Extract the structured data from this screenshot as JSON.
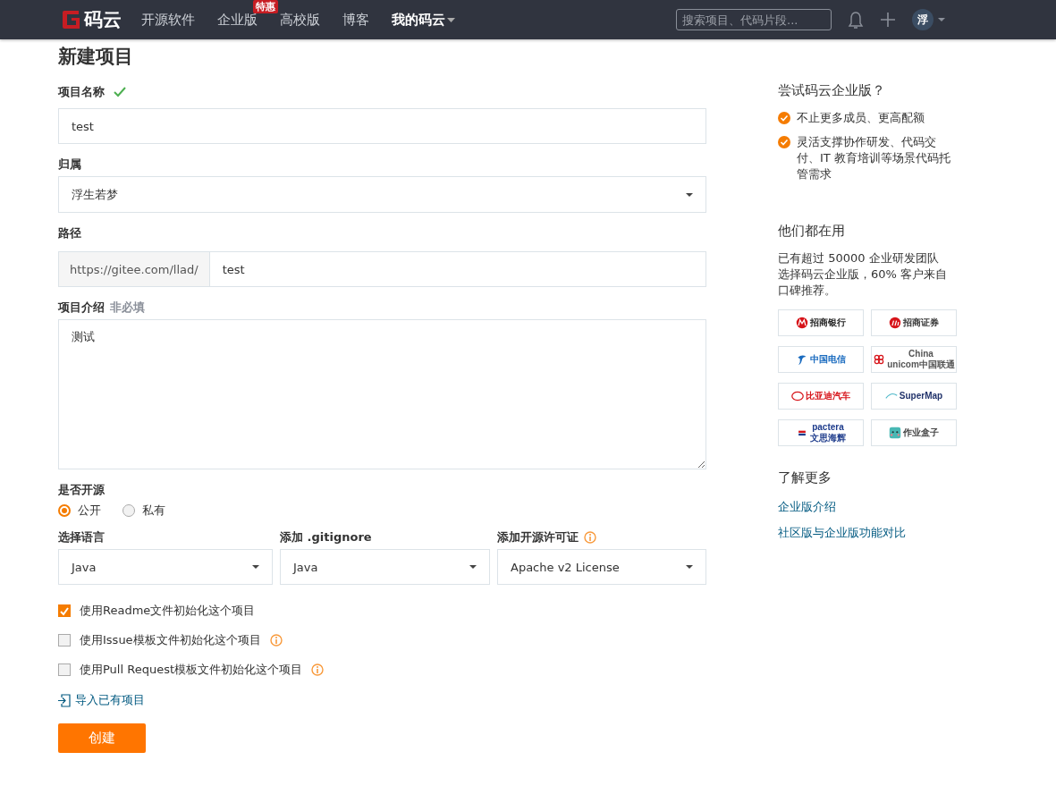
{
  "header": {
    "brand": "码云",
    "nav": [
      {
        "label": "开源软件",
        "dropdown": false
      },
      {
        "label": "企业版",
        "badge": "特惠",
        "dropdown": false
      },
      {
        "label": "高校版",
        "dropdown": false
      },
      {
        "label": "博客",
        "dropdown": false
      },
      {
        "label": "我的码云",
        "dropdown": true
      }
    ],
    "search": {
      "placeholder": "搜索项目、代码片段..."
    },
    "avatar": "浮"
  },
  "page_title": "新建项目",
  "form": {
    "name": {
      "label": "项目名称",
      "valid": true,
      "value": "test"
    },
    "owner": {
      "label": "归属",
      "value": "浮生若梦"
    },
    "path": {
      "label": "路径",
      "prefix": "https://gitee.com/llad/",
      "value": "test"
    },
    "description": {
      "label": "项目介绍",
      "hint": "非必填",
      "value": "测试"
    },
    "visibility": {
      "label": "是否开源",
      "options": [
        {
          "label": "公开",
          "selected": true
        },
        {
          "label": "私有",
          "selected": false
        }
      ]
    },
    "selects": [
      {
        "label": "选择语言",
        "value": "Java",
        "info": false
      },
      {
        "label": "添加 .gitignore",
        "value": "Java",
        "info": false
      },
      {
        "label": "添加开源许可证",
        "value": "Apache v2 License",
        "info": true
      }
    ],
    "checkboxes": [
      {
        "label": "使用Readme文件初始化这个项目",
        "checked": true,
        "info": false
      },
      {
        "label": "使用Issue模板文件初始化这个项目",
        "checked": false,
        "info": true
      },
      {
        "label": "使用Pull Request模板文件初始化这个项目",
        "checked": false,
        "info": true
      }
    ],
    "import_link": "导入已有项目",
    "submit": "创建"
  },
  "sidebar": {
    "promo_title": "尝试码云企业版？",
    "promo_items": [
      "不止更多成员、更高配额",
      "灵活支撑协作研发、代码交付、IT 教育培训等场景代码托管需求"
    ],
    "users_title": "他们都在用",
    "users_text": "已有超过 50000 企业研发团队选择码云企业版，60% 客户来自口碑推荐。",
    "logos": [
      {
        "kind": "cmb",
        "lines": [
          "招商银行"
        ]
      },
      {
        "kind": "cms",
        "lines": [
          "招商证券"
        ]
      },
      {
        "kind": "telecom",
        "lines": [
          "中国电信"
        ]
      },
      {
        "kind": "unicom",
        "lines": [
          "China",
          "unicom中国联通"
        ]
      },
      {
        "kind": "byd",
        "lines": [
          "比亚迪汽车"
        ]
      },
      {
        "kind": "supermap",
        "lines": [
          "SuperMap"
        ]
      },
      {
        "kind": "pactera",
        "lines": [
          "pactera",
          "文思海辉"
        ]
      },
      {
        "kind": "box",
        "lines": [
          "作业盒子"
        ]
      }
    ],
    "more_title": "了解更多",
    "links": [
      "企业版介绍",
      "社区版与企业版功能对比"
    ]
  }
}
